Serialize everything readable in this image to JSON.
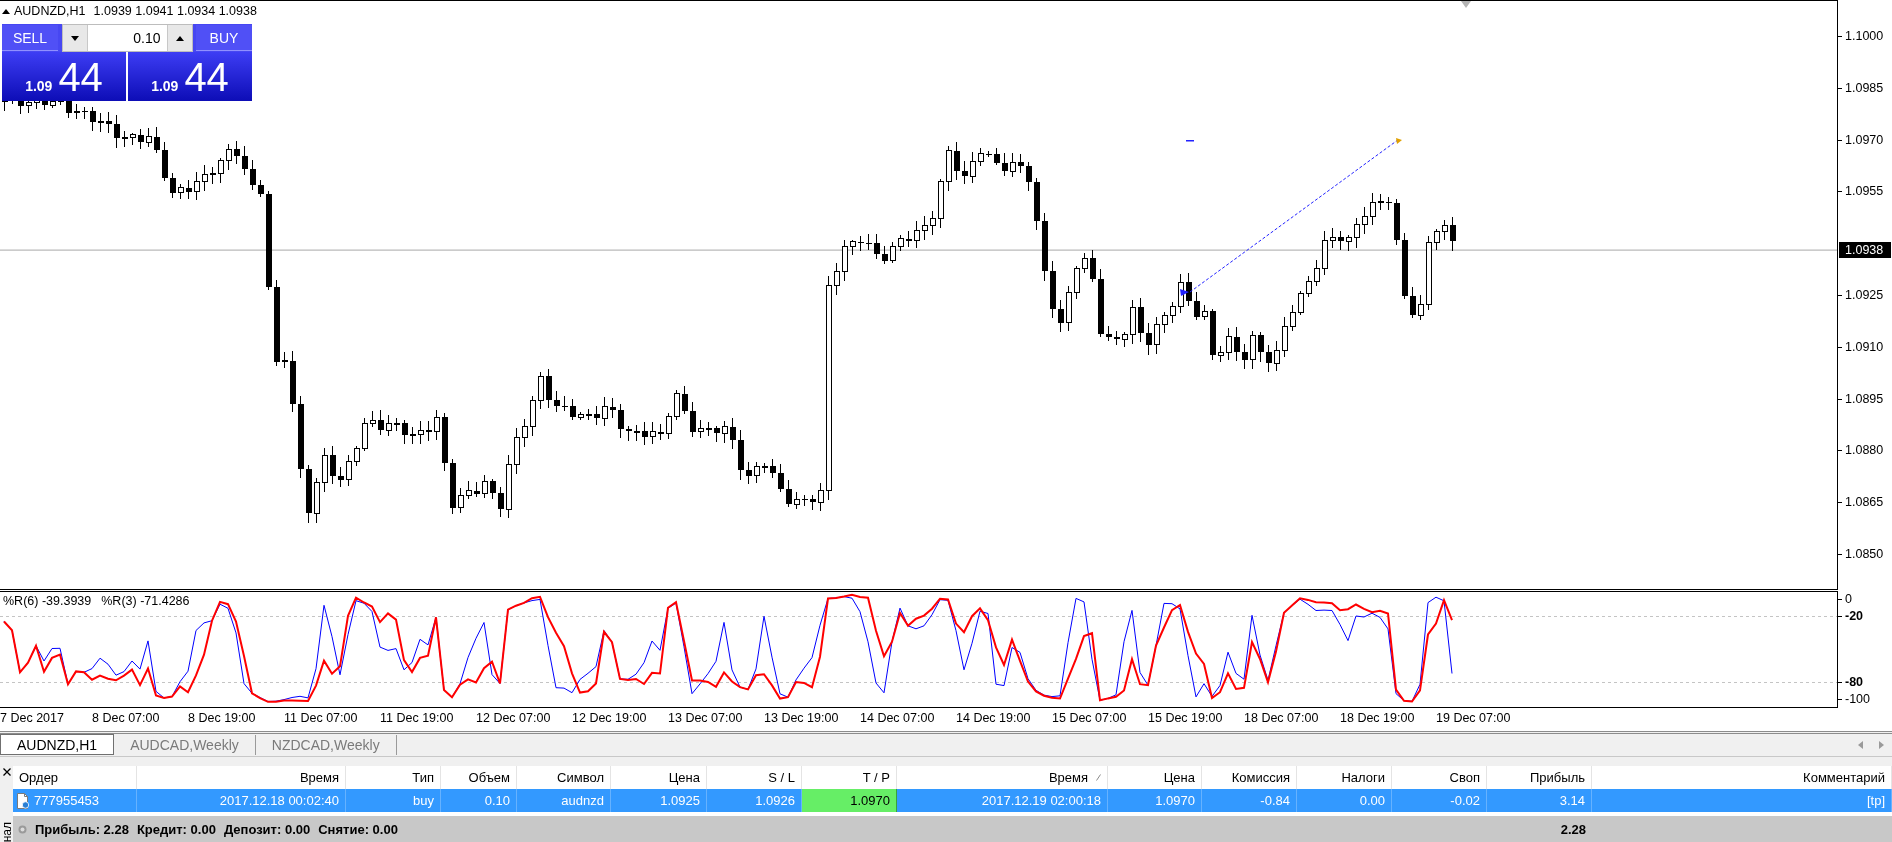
{
  "chart": {
    "symbol": "AUDNZD,H1",
    "quotes": "1.0939 1.0941 1.0934 1.0938",
    "trade_panel": {
      "sell": {
        "label": "SELL",
        "price_prefix": "1.09",
        "price_pips": "44"
      },
      "volume": "0.10",
      "buy": {
        "label": "BUY",
        "price_prefix": "1.09",
        "price_pips": "44"
      }
    },
    "price_axis": {
      "ticks": [
        "1.1000",
        "1.0985",
        "1.0970",
        "1.0955",
        "1.0925",
        "1.0910",
        "1.0895",
        "1.0880",
        "1.0865",
        "1.0850"
      ],
      "current_price": "1.0938"
    },
    "indicator": {
      "legend": [
        {
          "name": "%R(6)",
          "value": "-39.3939"
        },
        {
          "name": "%R(3)",
          "value": "-71.4286"
        }
      ],
      "axis": [
        {
          "label": "0",
          "kind": "bound"
        },
        {
          "label": "-20",
          "kind": "level"
        },
        {
          "label": "-80",
          "kind": "level"
        },
        {
          "label": "-100",
          "kind": "bound"
        }
      ]
    },
    "time_axis": [
      "7 Dec 2017",
      "8 Dec 07:00",
      "8 Dec 19:00",
      "11 Dec 07:00",
      "11 Dec 19:00",
      "12 Dec 07:00",
      "12 Dec 19:00",
      "13 Dec 07:00",
      "13 Dec 19:00",
      "14 Dec 07:00",
      "14 Dec 19:00",
      "15 Dec 07:00",
      "15 Dec 19:00",
      "18 Dec 07:00",
      "18 Dec 19:00",
      "19 Dec 07:00"
    ]
  },
  "chart_tabs": [
    {
      "label": "AUDNZD,H1",
      "selected": true
    },
    {
      "label": "AUDCAD,Weekly",
      "selected": false
    },
    {
      "label": "NZDCAD,Weekly",
      "selected": false
    }
  ],
  "terminal": {
    "side_title": "нал",
    "columns": [
      {
        "label": "Ордер",
        "sorted": false
      },
      {
        "label": "Время",
        "sorted": false
      },
      {
        "label": "Тип",
        "sorted": false
      },
      {
        "label": "Объем",
        "sorted": false
      },
      {
        "label": "Символ",
        "sorted": false
      },
      {
        "label": "Цена",
        "sorted": false
      },
      {
        "label": "S / L",
        "sorted": false
      },
      {
        "label": "T / P",
        "sorted": false
      },
      {
        "label": "Время",
        "sorted": true
      },
      {
        "label": "Цена",
        "sorted": false
      },
      {
        "label": "Комиссия",
        "sorted": false
      },
      {
        "label": "Налоги",
        "sorted": false
      },
      {
        "label": "Своп",
        "sorted": false
      },
      {
        "label": "Прибыль",
        "sorted": false
      },
      {
        "label": "Комментарий",
        "sorted": false
      }
    ],
    "rows": [
      {
        "selected": true,
        "cells": [
          {
            "text": "777955453",
            "highlighted": false
          },
          {
            "text": "2017.12.18 00:02:40",
            "highlighted": false
          },
          {
            "text": "buy",
            "highlighted": false
          },
          {
            "text": "0.10",
            "highlighted": false
          },
          {
            "text": "audnzd",
            "highlighted": false
          },
          {
            "text": "1.0925",
            "highlighted": false
          },
          {
            "text": "1.0926",
            "highlighted": false
          },
          {
            "text": "1.0970",
            "highlighted": true
          },
          {
            "text": "2017.12.19 02:00:18",
            "highlighted": false
          },
          {
            "text": "1.0970",
            "highlighted": false
          },
          {
            "text": "-0.84",
            "highlighted": false
          },
          {
            "text": "0.00",
            "highlighted": false
          },
          {
            "text": "-0.02",
            "highlighted": false
          },
          {
            "text": "3.14",
            "highlighted": false
          },
          {
            "text": "[tp]",
            "highlighted": false
          }
        ]
      }
    ],
    "summary": {
      "items": [
        {
          "label": "Прибыль:",
          "value": "2.28"
        },
        {
          "label": "Кредит:",
          "value": "0.00"
        },
        {
          "label": "Депозит:",
          "value": "0.00"
        },
        {
          "label": "Снятие:",
          "value": "0.00"
        }
      ],
      "total": "2.28"
    }
  }
}
